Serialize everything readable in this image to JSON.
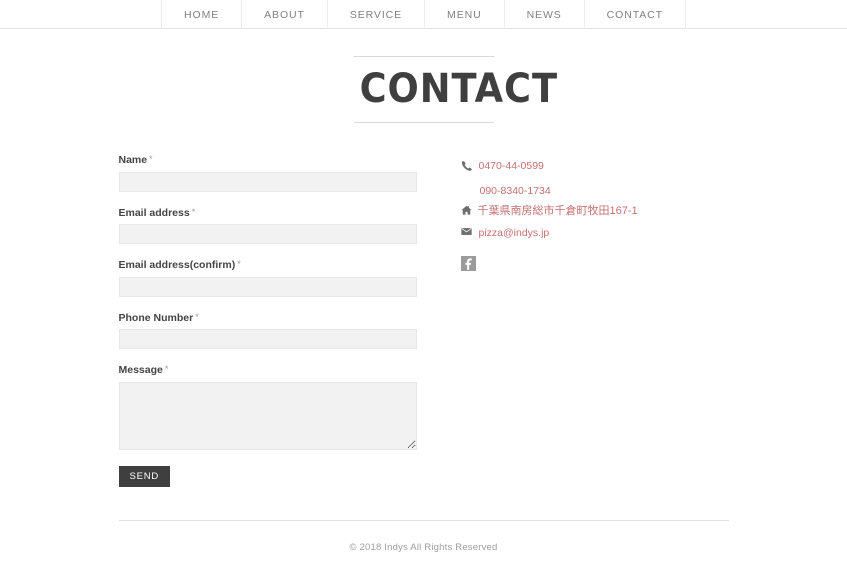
{
  "nav": {
    "items": [
      {
        "label": "HOME",
        "name": "nav-item-home"
      },
      {
        "label": "ABOUT",
        "name": "nav-item-about"
      },
      {
        "label": "SERVICE",
        "name": "nav-item-service"
      },
      {
        "label": "MENU",
        "name": "nav-item-menu"
      },
      {
        "label": "NEWS",
        "name": "nav-item-news"
      },
      {
        "label": "CONTACT",
        "name": "nav-item-contact"
      }
    ]
  },
  "page": {
    "title": "CONTACT"
  },
  "form": {
    "required_marker": "*",
    "fields": {
      "name": {
        "label": "Name",
        "value": "",
        "placeholder": ""
      },
      "email": {
        "label": "Email address",
        "value": "",
        "placeholder": ""
      },
      "email_confirm": {
        "label": "Email address(confirm)",
        "value": "",
        "placeholder": ""
      },
      "phone": {
        "label": "Phone Number",
        "value": "",
        "placeholder": ""
      },
      "message": {
        "label": "Message",
        "value": "",
        "placeholder": ""
      }
    },
    "submit_label": "SEND"
  },
  "contact_info": {
    "phone_primary": "0470-44-0599",
    "phone_secondary": "090-8340-1734",
    "address": "千葉県南房総市千倉町牧田167-1",
    "email": "pizza@indys.jp",
    "link_color": "#c4706e"
  },
  "social": {
    "facebook_label": "f"
  },
  "footer": {
    "copyright": "© 2018 Indys All Rights Reserved"
  },
  "theme": {
    "accent": "#c4706e",
    "button_bg": "#3f3f3f",
    "input_bg": "#f2f2f2",
    "nav_text": "#808080"
  }
}
